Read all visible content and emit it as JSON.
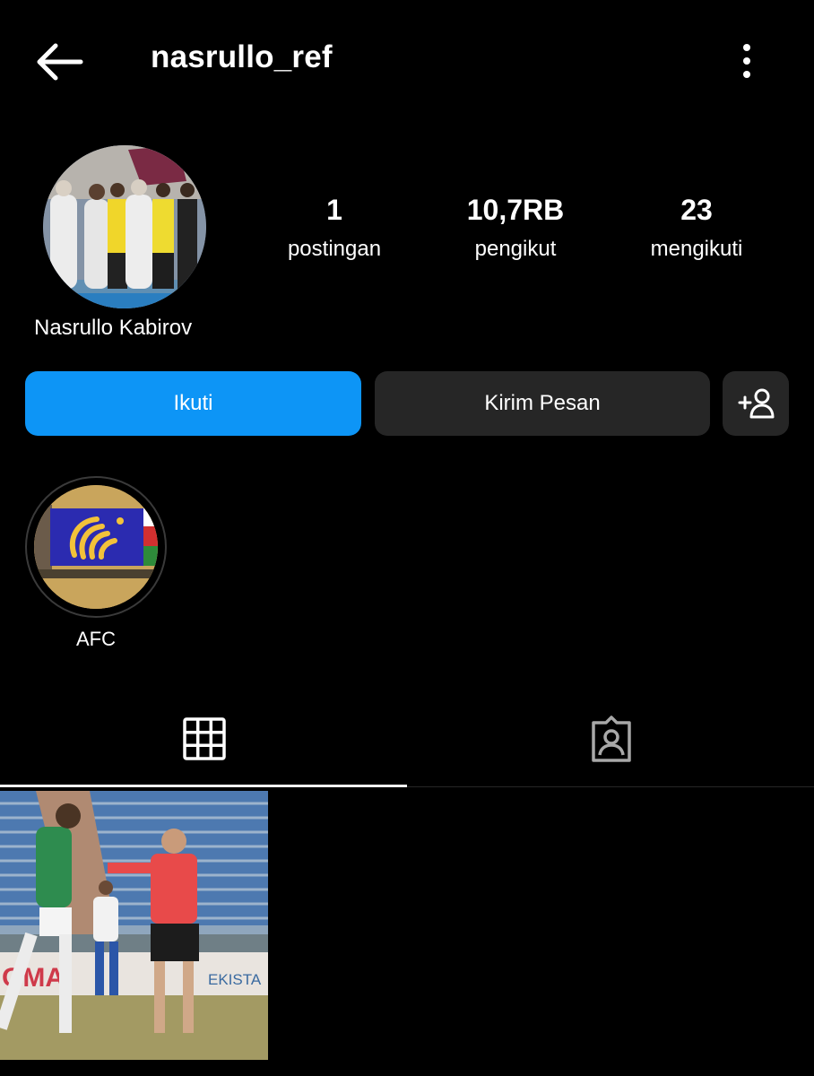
{
  "header": {
    "back_icon": "arrow-left-icon",
    "username": "nasrullo_ref",
    "more_icon": "vertical-ellipsis-icon"
  },
  "profile": {
    "display_name": "Nasrullo Kabirov",
    "stats": [
      {
        "value": "1",
        "label": "postingan"
      },
      {
        "value": "10,7RB",
        "label": "pengikut"
      },
      {
        "value": "23",
        "label": "mengikuti"
      }
    ]
  },
  "actions": {
    "follow_label": "Ikuti",
    "message_label": "Kirim Pesan",
    "add_person_icon": "add-person-icon"
  },
  "highlights": [
    {
      "label": "AFC"
    }
  ],
  "tabs": [
    {
      "icon": "grid-icon",
      "active": true
    },
    {
      "icon": "tagged-person-icon",
      "active": false
    }
  ],
  "colors": {
    "background": "#000000",
    "primary_button": "#0d95f6",
    "secondary_button": "#262626"
  }
}
